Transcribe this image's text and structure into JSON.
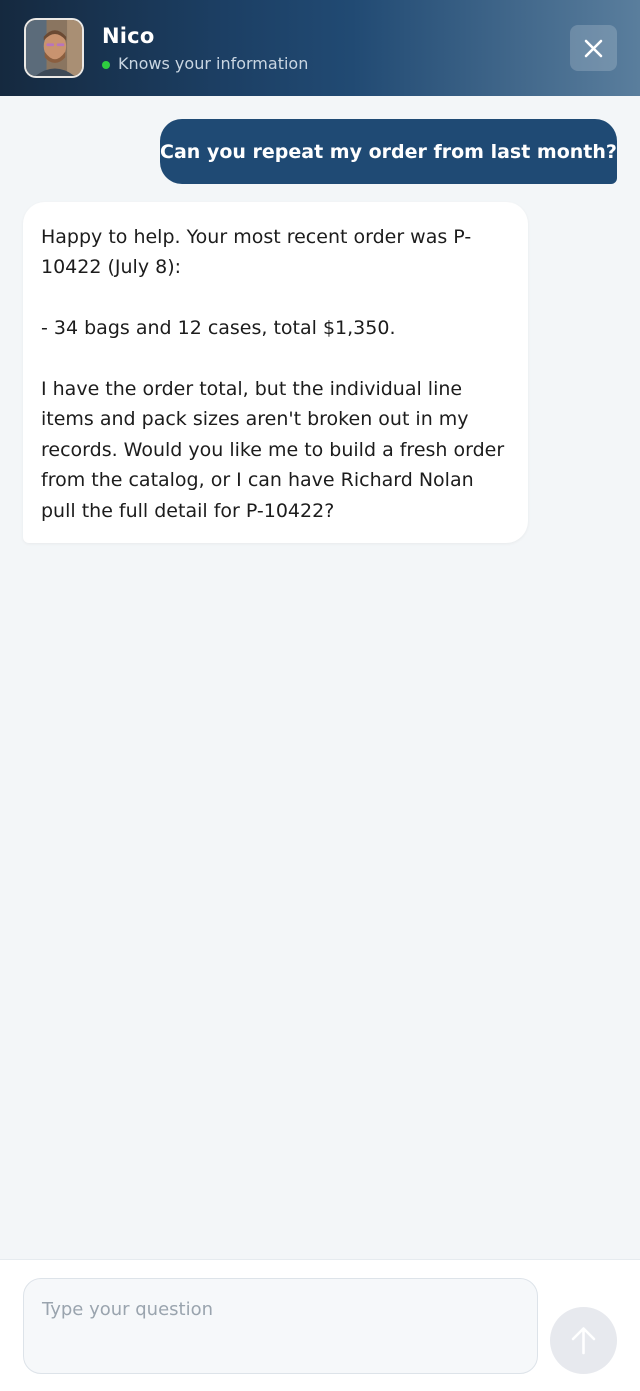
{
  "header": {
    "agent_name": "Nico",
    "status_text": "Knows your information",
    "status_color": "#2ecc40",
    "close_icon": "close-icon"
  },
  "messages": [
    {
      "role": "user",
      "text": "Can you repeat my order from last month?"
    },
    {
      "role": "assistant",
      "text": "Happy to help. Your most recent order was P-10422 (July 8):\n\n- 34 bags and 12 cases, total $1,350.\n\nI have the order total, but the individual line items and pack sizes aren't broken out in my records. Would you like me to build a fresh order from the catalog, or I can have Richard Nolan pull the full detail for P-10422?"
    }
  ],
  "composer": {
    "placeholder": "Type your question",
    "value": "",
    "send_icon": "arrow-up-icon"
  },
  "colors": {
    "accent": "#1f4a74",
    "background": "#f3f6f8"
  }
}
